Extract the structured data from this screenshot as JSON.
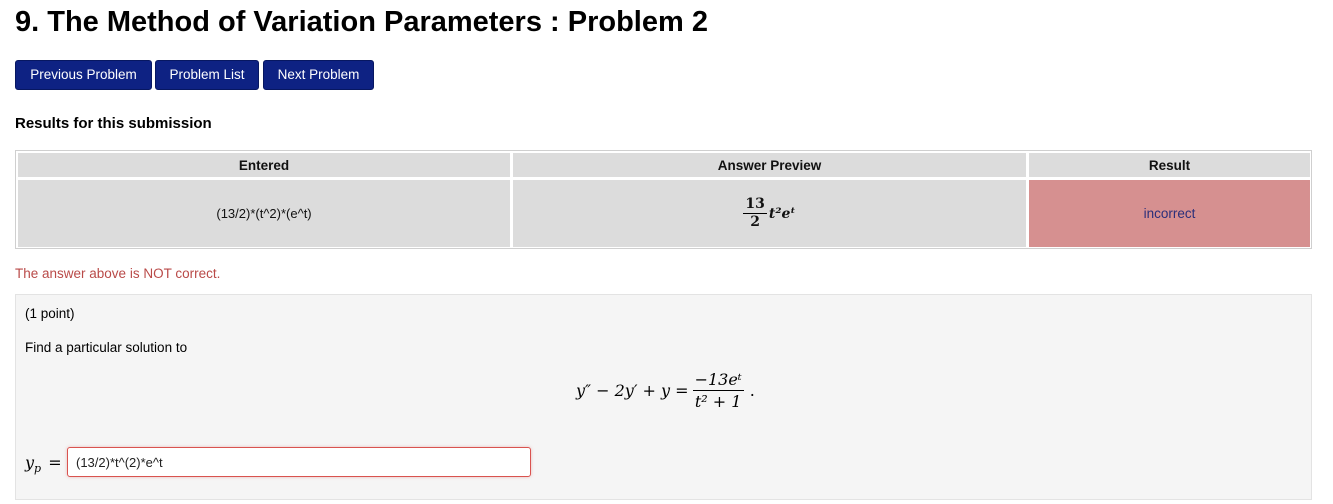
{
  "page": {
    "title": "9. The Method of Variation Parameters : Problem 2"
  },
  "nav": {
    "previous_label": "Previous Problem",
    "list_label": "Problem List",
    "next_label": "Next Problem"
  },
  "results": {
    "heading": "Results for this submission",
    "columns": [
      "Entered",
      "Answer Preview",
      "Result"
    ],
    "rows": [
      {
        "entered": "(13/2)*(t^2)*(e^t)",
        "preview": {
          "coefficient_numerator": "13",
          "coefficient_denominator": "2",
          "expression": "t²eᵗ"
        },
        "result": "incorrect"
      }
    ],
    "feedback": "The answer above is NOT correct."
  },
  "problem": {
    "points": "(1 point)",
    "prompt": "Find a particular solution to",
    "equation": {
      "lhs": "y″ − 2y′ + y =",
      "numerator": "−13eᵗ",
      "denominator": "t² + 1",
      "trailing": "."
    },
    "answer": {
      "label": "y",
      "label_sub": "p",
      "equals": "=",
      "value": "(13/2)*t^(2)*e^t"
    }
  },
  "colors": {
    "nav_button": "#0e2283",
    "incorrect_bg": "#d69090",
    "feedback_text": "#b94a48",
    "table_cell": "#dcdcdc",
    "problem_bg": "#f5f5f5"
  }
}
